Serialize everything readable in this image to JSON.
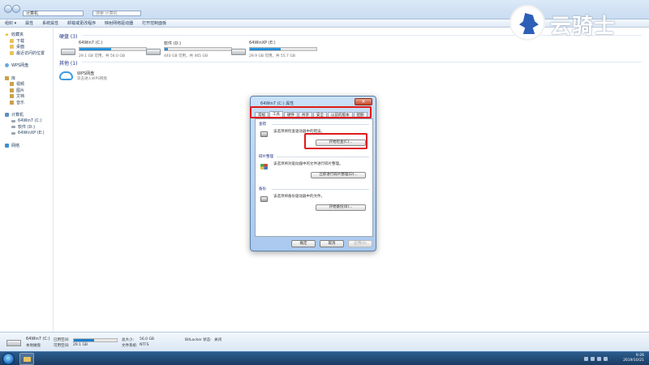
{
  "window": {
    "address_path": "计算机",
    "search_placeholder": "搜索 计算机"
  },
  "toolbar": {
    "items": [
      "组织 ▾",
      "属性",
      "系统属性",
      "卸载或更改程序",
      "映射网络驱动器",
      "打开控制面板"
    ]
  },
  "sidebar": {
    "favorites": {
      "label": "收藏夹",
      "items": [
        "下载",
        "桌面",
        "最近访问的位置"
      ]
    },
    "wps": "WPS网盘",
    "libraries": {
      "label": "库",
      "items": [
        "视频",
        "图片",
        "文档",
        "音乐"
      ]
    },
    "computer": {
      "label": "计算机",
      "items": [
        "64Win7 (C:)",
        "软件 (D:)",
        "64WinXP (E:)"
      ]
    },
    "network": "网络"
  },
  "main": {
    "hard_disks_header": "硬盘 (3)",
    "other_header": "其他 (1)",
    "drives": [
      {
        "name": "64Win7 (C:)",
        "free": "29.1 GB 可用，共 56.0 GB",
        "used_fraction": 0.48
      },
      {
        "name": "软件 (D:)",
        "free": "440 GB 可用，共 465 GB",
        "used_fraction": 0.05
      },
      {
        "name": "64WinXP (E:)",
        "free": "29.9 GB 可用，共 55.7 GB",
        "used_fraction": 0.46
      }
    ],
    "wps_item": {
      "name": "WPS网盘",
      "desc": "双击进入WPS网盘"
    }
  },
  "details": {
    "drive_name": "64Win7 (C:)",
    "drive_type": "本地磁盘",
    "used_label": "已用空间:",
    "free_label": "可用空间:",
    "free_value": "29.1 GB",
    "total_label": "总大小:",
    "total_value": "56.0 GB",
    "fs_label": "文件系统:",
    "fs_value": "NTFS",
    "bitlocker_label": "BitLocker 状态:",
    "bitlocker_value": "关闭",
    "used_fraction": 0.48
  },
  "dialog": {
    "title": "64Win7 (C:) 属性",
    "close_label": "✕",
    "tabs": [
      "常规",
      "工具",
      "硬件",
      "共享",
      "安全",
      "以前的版本",
      "配额"
    ],
    "active_tab": 1,
    "groups": [
      {
        "title": "查错",
        "desc": "该选项将检查驱动器中的错误。",
        "button": "开始检查(C)..."
      },
      {
        "title": "碎片整理",
        "desc": "该选项将对驱动器中的文件进行碎片整理。",
        "button": "立即进行碎片整理(D)..."
      },
      {
        "title": "备份",
        "desc": "该选项将备份驱动器中的文件。",
        "button": "开始备份(B)..."
      }
    ],
    "ok": "确定",
    "cancel": "取消",
    "apply": "应用(A)"
  },
  "taskbar": {
    "time": "9:26",
    "date": "2019/10/21"
  },
  "watermark": {
    "text": "云骑士"
  },
  "colors": {
    "highlight": "#e01a1a",
    "bar_fill": "#1a7fcc"
  }
}
